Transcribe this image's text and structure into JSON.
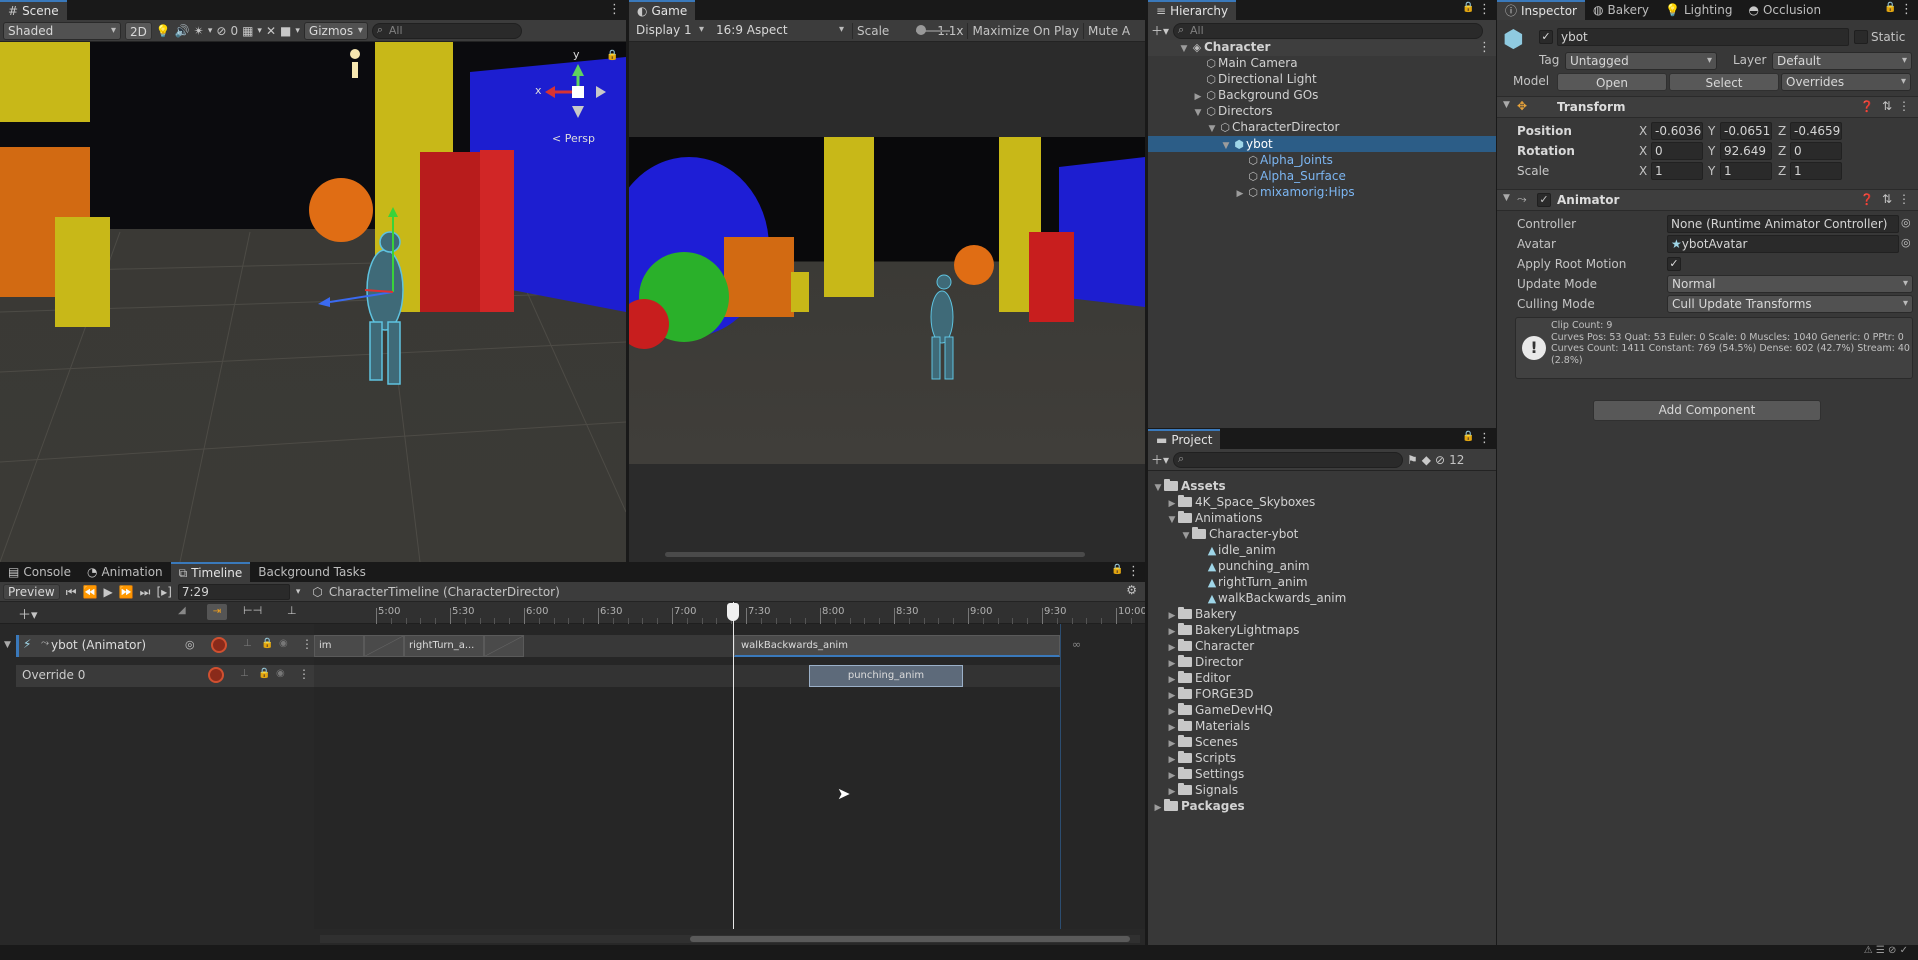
{
  "scene": {
    "tab": "Scene",
    "shading": "Shaded",
    "toggle_2d": "2D",
    "layers_count": "0",
    "gizmos": "Gizmos",
    "search_placeholder": "All",
    "persp": "Persp",
    "axis_x": "x",
    "axis_y": "y"
  },
  "game": {
    "tab": "Game",
    "display": "Display 1",
    "aspect": "16:9 Aspect",
    "scale_label": "Scale",
    "scale_value": "1.1x",
    "maximize": "Maximize On Play",
    "mute": "Mute A"
  },
  "hierarchy": {
    "tab": "Hierarchy",
    "search_placeholder": "All",
    "items": [
      {
        "label": "Character"
      },
      {
        "label": "Main Camera"
      },
      {
        "label": "Directional Light"
      },
      {
        "label": "Background GOs"
      },
      {
        "label": "Directors"
      },
      {
        "label": "CharacterDirector"
      },
      {
        "label": "ybot"
      },
      {
        "label": "Alpha_Joints"
      },
      {
        "label": "Alpha_Surface"
      },
      {
        "label": "mixamorig:Hips"
      }
    ]
  },
  "inspector": {
    "tabs": [
      "Inspector",
      "Bakery",
      "Lighting",
      "Occlusion"
    ],
    "object_name": "ybot",
    "static_label": "Static",
    "tag_label": "Tag",
    "tag_value": "Untagged",
    "layer_label": "Layer",
    "layer_value": "Default",
    "model_label": "Model",
    "open_btn": "Open",
    "select_btn": "Select",
    "overrides": "Overrides",
    "transform": {
      "title": "Transform",
      "position_label": "Position",
      "rotation_label": "Rotation",
      "scale_label": "Scale",
      "x": "X",
      "y": "Y",
      "z": "Z",
      "position": [
        "-0.603656",
        "-0.065159",
        "-0.465929"
      ],
      "rotation": [
        "0",
        "92.649",
        "0"
      ],
      "scale": [
        "1",
        "1",
        "1"
      ]
    },
    "animator": {
      "title": "Animator",
      "controller_label": "Controller",
      "controller_value": "None (Runtime Animator Controller)",
      "avatar_label": "Avatar",
      "avatar_value": "ybotAvatar",
      "apply_root_motion_label": "Apply Root Motion",
      "update_mode_label": "Update Mode",
      "update_mode_value": "Normal",
      "culling_mode_label": "Culling Mode",
      "culling_mode_value": "Cull Update Transforms",
      "info_line1": "Clip Count: 9",
      "info_line2": "Curves Pos: 53 Quat: 53 Euler: 0 Scale: 0 Muscles: 1040 Generic: 0 PPtr: 0",
      "info_line3": "Curves Count: 1411 Constant: 769 (54.5%) Dense: 602 (42.7%) Stream: 40",
      "info_line4": "(2.8%)"
    },
    "add_component": "Add Component"
  },
  "project": {
    "tab": "Project",
    "hidden_count": "12",
    "items": [
      {
        "label": "Assets"
      },
      {
        "label": "4K_Space_Skyboxes"
      },
      {
        "label": "Animations"
      },
      {
        "label": "Character-ybot"
      },
      {
        "label": "idle_anim"
      },
      {
        "label": "punching_anim"
      },
      {
        "label": "rightTurn_anim"
      },
      {
        "label": "walkBackwards_anim"
      },
      {
        "label": "Bakery"
      },
      {
        "label": "BakeryLightmaps"
      },
      {
        "label": "Character"
      },
      {
        "label": "Director"
      },
      {
        "label": "Editor"
      },
      {
        "label": "FORGE3D"
      },
      {
        "label": "GameDevHQ"
      },
      {
        "label": "Materials"
      },
      {
        "label": "Scenes"
      },
      {
        "label": "Scripts"
      },
      {
        "label": "Settings"
      },
      {
        "label": "Signals"
      },
      {
        "label": "Packages"
      }
    ]
  },
  "timeline": {
    "tabs": [
      "Console",
      "Animation",
      "Timeline",
      "Background Tasks"
    ],
    "preview": "Preview",
    "time": "7:29",
    "asset": "CharacterTimeline (CharacterDirector)",
    "ticks": [
      "5:00",
      "5:30",
      "6:00",
      "6:30",
      "7:00",
      "7:30",
      "8:00",
      "8:30",
      "9:00",
      "9:30",
      "10:00"
    ],
    "track_name": "ybot (Animator)",
    "override_name": "Override 0",
    "clips": {
      "clip_a": "im",
      "clip_b": "rightTurn_a...",
      "clip_c": "walkBackwards_anim",
      "clip_d": "punching_anim"
    }
  },
  "colors": {
    "accent": "#3a79bb",
    "selection": "#2c5d87"
  }
}
